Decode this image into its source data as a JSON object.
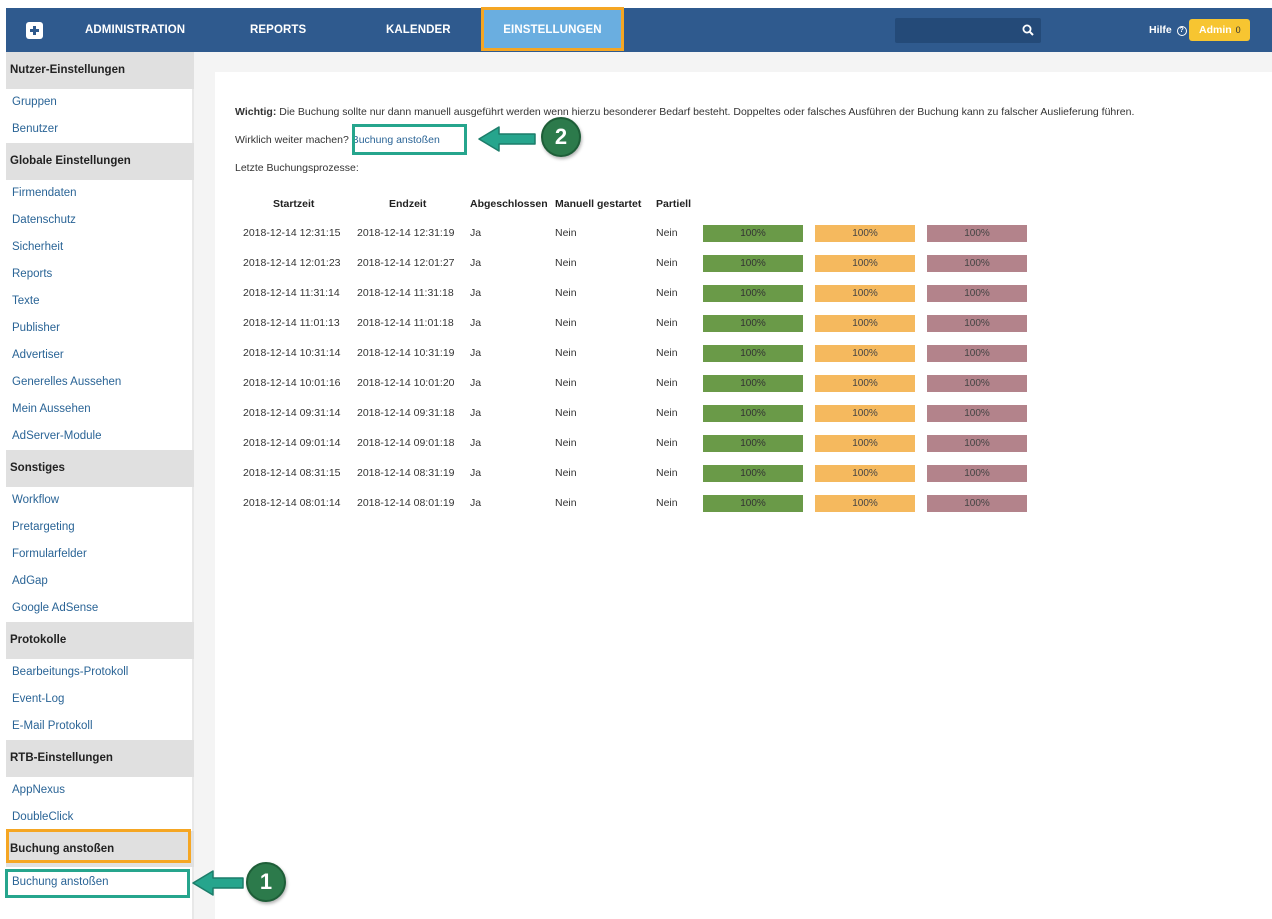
{
  "nav": {
    "administration": "ADMINISTRATION",
    "reports": "REPORTS",
    "kalender": "KALENDER",
    "einstellungen": "EINSTELLUNGEN",
    "hilfe": "Hilfe",
    "hilfe_icon": "?",
    "admin": "Admin",
    "admin_count": "0"
  },
  "sidebar": {
    "sections": [
      {
        "title": "Nutzer-Einstellungen",
        "items": [
          "Gruppen",
          "Benutzer"
        ]
      },
      {
        "title": "Globale Einstellungen",
        "items": [
          "Firmendaten",
          "Datenschutz",
          "Sicherheit",
          "Reports",
          "Texte",
          "Publisher",
          "Advertiser",
          "Generelles Aussehen",
          "Mein Aussehen",
          "AdServer-Module"
        ]
      },
      {
        "title": "Sonstiges",
        "items": [
          "Workflow",
          "Pretargeting",
          "Formularfelder",
          "AdGap",
          "Google AdSense"
        ]
      },
      {
        "title": "Protokolle",
        "items": [
          "Bearbeitungs-Protokoll",
          "Event-Log",
          "E-Mail Protokoll"
        ]
      },
      {
        "title": "RTB-Einstellungen",
        "items": [
          "AppNexus",
          "DoubleClick"
        ]
      },
      {
        "title": "Buchung anstoßen",
        "items": [
          "Buchung anstoßen"
        ]
      }
    ]
  },
  "main": {
    "warning_label": "Wichtig:",
    "warning_text": " Die Buchung sollte nur dann manuell ausgeführt werden wenn hierzu besonderer Bedarf besteht. Doppeltes oder falsches Ausführen der Buchung kann zu falscher Auslieferung führen.",
    "confirm_text": "Wirklich weiter machen?",
    "confirm_link": "Buchung anstoßen",
    "last_processes": "Letzte Buchungsprozesse:",
    "columns": [
      "Startzeit",
      "Endzeit",
      "Abgeschlossen",
      "Manuell gestartet",
      "Partiell"
    ],
    "rows": [
      {
        "start": "2018-12-14 12:31:15",
        "end": "2018-12-14 12:31:19",
        "done": "Ja",
        "manual": "Nein",
        "partial": "Nein",
        "p1": "100%",
        "p2": "100%",
        "p3": "100%"
      },
      {
        "start": "2018-12-14 12:01:23",
        "end": "2018-12-14 12:01:27",
        "done": "Ja",
        "manual": "Nein",
        "partial": "Nein",
        "p1": "100%",
        "p2": "100%",
        "p3": "100%"
      },
      {
        "start": "2018-12-14 11:31:14",
        "end": "2018-12-14 11:31:18",
        "done": "Ja",
        "manual": "Nein",
        "partial": "Nein",
        "p1": "100%",
        "p2": "100%",
        "p3": "100%"
      },
      {
        "start": "2018-12-14 11:01:13",
        "end": "2018-12-14 11:01:18",
        "done": "Ja",
        "manual": "Nein",
        "partial": "Nein",
        "p1": "100%",
        "p2": "100%",
        "p3": "100%"
      },
      {
        "start": "2018-12-14 10:31:14",
        "end": "2018-12-14 10:31:19",
        "done": "Ja",
        "manual": "Nein",
        "partial": "Nein",
        "p1": "100%",
        "p2": "100%",
        "p3": "100%"
      },
      {
        "start": "2018-12-14 10:01:16",
        "end": "2018-12-14 10:01:20",
        "done": "Ja",
        "manual": "Nein",
        "partial": "Nein",
        "p1": "100%",
        "p2": "100%",
        "p3": "100%"
      },
      {
        "start": "2018-12-14 09:31:14",
        "end": "2018-12-14 09:31:18",
        "done": "Ja",
        "manual": "Nein",
        "partial": "Nein",
        "p1": "100%",
        "p2": "100%",
        "p3": "100%"
      },
      {
        "start": "2018-12-14 09:01:14",
        "end": "2018-12-14 09:01:18",
        "done": "Ja",
        "manual": "Nein",
        "partial": "Nein",
        "p1": "100%",
        "p2": "100%",
        "p3": "100%"
      },
      {
        "start": "2018-12-14 08:31:15",
        "end": "2018-12-14 08:31:19",
        "done": "Ja",
        "manual": "Nein",
        "partial": "Nein",
        "p1": "100%",
        "p2": "100%",
        "p3": "100%"
      },
      {
        "start": "2018-12-14 08:01:14",
        "end": "2018-12-14 08:01:19",
        "done": "Ja",
        "manual": "Nein",
        "partial": "Nein",
        "p1": "100%",
        "p2": "100%",
        "p3": "100%"
      }
    ]
  },
  "annotations": {
    "step1": "1",
    "step2": "2"
  },
  "colors": {
    "topbar": "#2f5a8e",
    "active_tab": "#6aaee0",
    "highlight_orange": "#f5a623",
    "highlight_teal": "#26a58d",
    "bar_green": "#6a9a48",
    "bar_orange": "#f5b95e",
    "bar_red": "#b3838b"
  },
  "icons": {
    "logo": "plus-square-icon",
    "search": "search-icon",
    "help": "question-circle-icon"
  }
}
